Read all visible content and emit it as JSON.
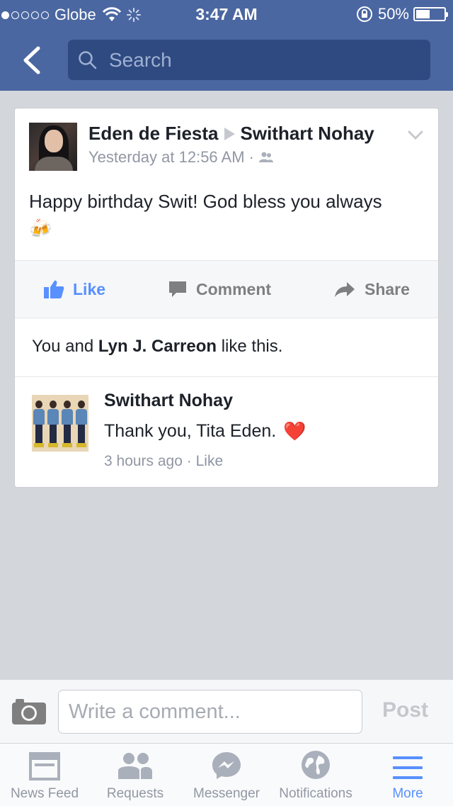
{
  "status_bar": {
    "carrier": "Globe",
    "time": "3:47 AM",
    "battery": "50%"
  },
  "nav": {
    "search_placeholder": "Search"
  },
  "post": {
    "author": "Eden de Fiesta",
    "target": "Swithart Nohay",
    "timestamp": "Yesterday at 12:56 AM",
    "separator": "·",
    "text": "Happy birthday Swit! God bless you always",
    "emoji": "🍻",
    "actions": {
      "like": "Like",
      "comment": "Comment",
      "share": "Share"
    },
    "likes": {
      "prefix": "You and ",
      "name": "Lyn J. Carreon",
      "suffix": " like this."
    },
    "comments": [
      {
        "author": "Swithart Nohay",
        "text": "Thank you, Tita Eden.",
        "emoji": "❤️",
        "time": "3 hours ago",
        "separator": "·",
        "like_label": "Like"
      }
    ]
  },
  "composer": {
    "placeholder": "Write a comment...",
    "post_label": "Post"
  },
  "tabbar": {
    "items": [
      {
        "label": "News Feed",
        "icon": "news-feed-icon"
      },
      {
        "label": "Requests",
        "icon": "requests-icon"
      },
      {
        "label": "Messenger",
        "icon": "messenger-icon"
      },
      {
        "label": "Notifications",
        "icon": "globe-icon"
      },
      {
        "label": "More",
        "icon": "menu-icon",
        "active": true
      }
    ]
  },
  "colors": {
    "brand": "#4b67a1",
    "accent": "#5890ff",
    "heart": "#e0282f"
  }
}
